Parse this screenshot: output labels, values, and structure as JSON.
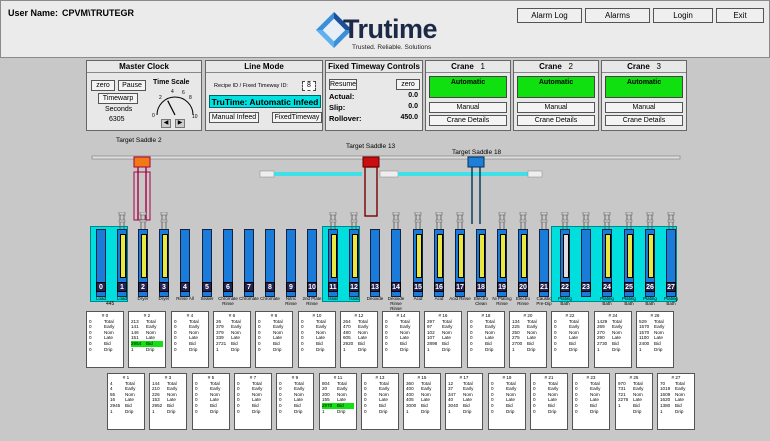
{
  "header": {
    "user_label": "User Name:",
    "user_value": "CPVM\\TRUTEGR",
    "logo_name": "Trutime",
    "logo_tagline": "Trusted. Reliable. Solutions",
    "buttons": [
      "Alarm Log",
      "Alarms",
      "Login",
      "Exit"
    ]
  },
  "master_clock": {
    "title": "Master Clock",
    "zero": "zero",
    "pause": "Pause",
    "timewarp": "Timewarp",
    "seconds_label": "Seconds",
    "seconds_value": "6305",
    "time_scale_label": "Time Scale",
    "gauge_ticks": [
      "0",
      "2",
      "4",
      "6",
      "8",
      "10"
    ],
    "time_scale_value": 0.35
  },
  "line_mode": {
    "title": "Line Mode",
    "recipe_label": "Recipe ID / Fixed Timeway ID:",
    "recipe_value": "8",
    "status": "TruTime: Automatic Infeed",
    "manual_infeed": "Manual Infeed",
    "fixed_timeway": "FixedTimeway"
  },
  "fixed_timeway": {
    "title": "Fixed Timeway Controls",
    "resume": "Resume",
    "zero": "zero",
    "actual_label": "Actual:",
    "actual_value": "0.0",
    "slip_label": "Slip:",
    "slip_value": "0.0",
    "rollover_label": "Rollover:",
    "rollover_value": "450.0"
  },
  "cranes": [
    {
      "title": "Crane",
      "number": "1",
      "mode": "Automatic",
      "manual": "Manual",
      "details": "Crane Details"
    },
    {
      "title": "Crane",
      "number": "2",
      "mode": "Automatic",
      "manual": "Manual",
      "details": "Crane Details"
    },
    {
      "title": "Crane",
      "number": "3",
      "mode": "Automatic",
      "manual": "Manual",
      "details": "Crane Details"
    }
  ],
  "targets": [
    {
      "label": "Target Saddle",
      "value": "2"
    },
    {
      "label": "Target Saddle",
      "value": "13"
    },
    {
      "label": "Target Saddle",
      "value": "18"
    }
  ],
  "load_count": "445",
  "tanks": [
    {
      "n": "0",
      "label": "Load"
    },
    {
      "n": "1",
      "label": "Load"
    },
    {
      "n": "2",
      "label": "Dryer"
    },
    {
      "n": "3",
      "label": "Dryer"
    },
    {
      "n": "4",
      "label": "Rinse All"
    },
    {
      "n": "5",
      "label": "Sealer"
    },
    {
      "n": "6",
      "label": "Chromate Rinse"
    },
    {
      "n": "7",
      "label": "Chromate"
    },
    {
      "n": "8",
      "label": "Chromate"
    },
    {
      "n": "9",
      "label": "Nitric Rinse"
    },
    {
      "n": "10",
      "label": "2nd Plate Rinse"
    },
    {
      "n": "11",
      "label": "Issat"
    },
    {
      "n": "12",
      "label": "Issat"
    },
    {
      "n": "13",
      "label": "Deoxide"
    },
    {
      "n": "14",
      "label": "Deoxide Rinse Rinse"
    },
    {
      "n": "15",
      "label": "Acid"
    },
    {
      "n": "16",
      "label": "Acid"
    },
    {
      "n": "17",
      "label": "Acid Rinse"
    },
    {
      "n": "18",
      "label": "Electro Clean"
    },
    {
      "n": "19",
      "label": "Ni Plating Rinse"
    },
    {
      "n": "20",
      "label": "Electro Rinse"
    },
    {
      "n": "21",
      "label": "Caustic Pre-Dip"
    },
    {
      "n": "22",
      "label": "Plating Bath"
    },
    {
      "n": "23",
      "label": ""
    },
    {
      "n": "24",
      "label": "Plating Bath"
    },
    {
      "n": "25",
      "label": "Plating Bath"
    },
    {
      "n": "26",
      "label": "Plating Bath"
    },
    {
      "n": "27",
      "label": "Plating Bath"
    }
  ],
  "cards": [
    {
      "id": "0",
      "v": [
        "0",
        "0",
        "0",
        "0",
        "0",
        "0"
      ]
    },
    {
      "id": "1",
      "v": [
        "4",
        "4",
        "55",
        "16",
        "2945",
        "1"
      ]
    },
    {
      "id": "2",
      "v": [
        "213",
        "141",
        "146",
        "151",
        "2954",
        "1"
      ],
      "hl": 4
    },
    {
      "id": "3",
      "v": [
        "144",
        "210",
        "226",
        "153",
        "2952",
        "1"
      ]
    },
    {
      "id": "4",
      "v": [
        "0",
        "0",
        "0",
        "0",
        "0",
        "0"
      ]
    },
    {
      "id": "5",
      "v": [
        "0",
        "0",
        "0",
        "0",
        "0",
        "0"
      ]
    },
    {
      "id": "6",
      "v": [
        "26",
        "379",
        "379",
        "339",
        "2721",
        "1"
      ]
    },
    {
      "id": "7",
      "v": [
        "0",
        "0",
        "0",
        "0",
        "0",
        "0"
      ]
    },
    {
      "id": "8",
      "v": [
        "0",
        "0",
        "0",
        "0",
        "0",
        "0"
      ]
    },
    {
      "id": "9",
      "v": [
        "0",
        "0",
        "0",
        "0",
        "0",
        "0"
      ]
    },
    {
      "id": "10",
      "v": [
        "0",
        "0",
        "0",
        "0",
        "0",
        "0"
      ]
    },
    {
      "id": "11",
      "v": [
        "804",
        "20",
        "200",
        "155",
        "2970",
        "1"
      ],
      "hl": 4
    },
    {
      "id": "12",
      "v": [
        "264",
        "470",
        "480",
        "605",
        "2920",
        "1"
      ]
    },
    {
      "id": "13",
      "v": [
        "0",
        "0",
        "0",
        "0",
        "0",
        "0"
      ]
    },
    {
      "id": "14",
      "v": [
        "0",
        "0",
        "0",
        "0",
        "0",
        "0"
      ]
    },
    {
      "id": "15",
      "v": [
        "360",
        "400",
        "400",
        "405",
        "3000",
        "1"
      ]
    },
    {
      "id": "16",
      "v": [
        "297",
        "97",
        "102",
        "107",
        "2898",
        "1"
      ]
    },
    {
      "id": "17",
      "v": [
        "12",
        "37",
        "347",
        "40",
        "3040",
        "1"
      ]
    },
    {
      "id": "18",
      "v": [
        "0",
        "0",
        "0",
        "0",
        "0",
        "0"
      ]
    },
    {
      "id": "19",
      "v": [
        "0",
        "0",
        "0",
        "0",
        "0",
        "0"
      ]
    },
    {
      "id": "20",
      "v": [
        "134",
        "225",
        "250",
        "275",
        "2700",
        "1"
      ]
    },
    {
      "id": "21",
      "v": [
        "0",
        "0",
        "0",
        "0",
        "0",
        "0"
      ]
    },
    {
      "id": "22",
      "v": [
        "0",
        "0",
        "0",
        "0",
        "0",
        "0"
      ]
    },
    {
      "id": "23",
      "v": [
        "0",
        "0",
        "0",
        "0",
        "0",
        "0"
      ]
    },
    {
      "id": "24",
      "v": [
        "1429",
        "269",
        "270",
        "290",
        "2730",
        "1"
      ]
    },
    {
      "id": "25",
      "v": [
        "970",
        "731",
        "721",
        "2276",
        "1",
        " "
      ]
    },
    {
      "id": "26",
      "v": [
        "529",
        "1570",
        "1570",
        "1100",
        "2400",
        "1"
      ]
    },
    {
      "id": "27",
      "v": [
        "70",
        "1019",
        "1609",
        "1620",
        "1380",
        "1"
      ]
    }
  ],
  "card_labels": [
    "Total",
    "Early",
    "Nom",
    "Late",
    "Bid",
    "Drip"
  ]
}
